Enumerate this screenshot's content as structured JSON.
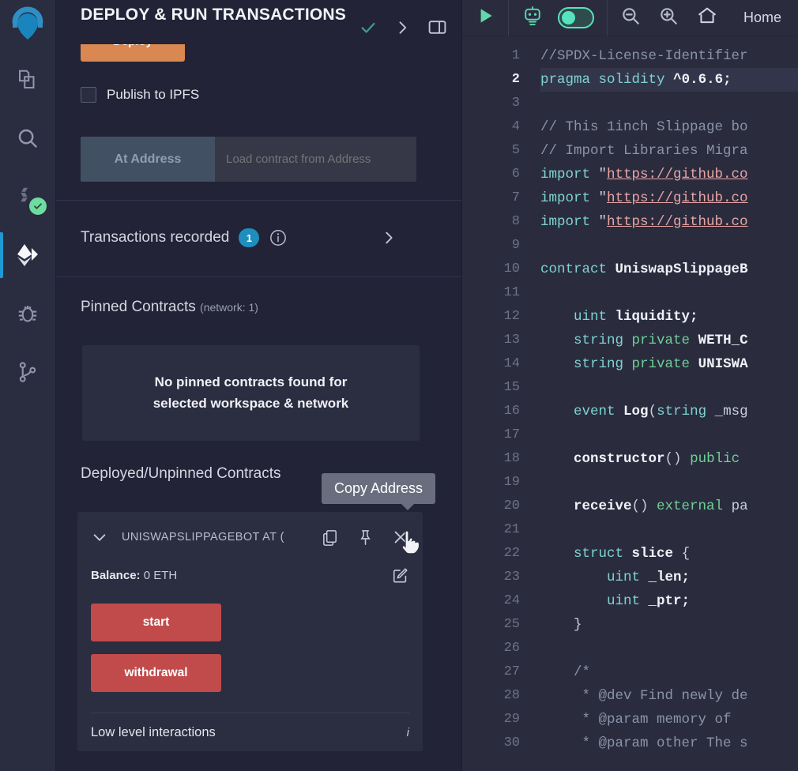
{
  "iconbar": {
    "logo_name": "remix-logo",
    "items": [
      {
        "name": "file-explorer-icon",
        "label": "File explorer",
        "active": false,
        "badge": false
      },
      {
        "name": "search-icon",
        "label": "Search in files",
        "active": false,
        "badge": false
      },
      {
        "name": "solidity-compiler-icon",
        "label": "Solidity compiler",
        "active": false,
        "badge": true
      },
      {
        "name": "deploy-run-icon",
        "label": "Deploy & run transactions",
        "active": true,
        "badge": false
      },
      {
        "name": "debugger-bug-icon",
        "label": "Debugger",
        "active": false,
        "badge": false
      },
      {
        "name": "git-branch-icon",
        "label": "Git",
        "active": false,
        "badge": false
      }
    ]
  },
  "panel": {
    "title": "Deploy & run transactions",
    "header_icons": [
      {
        "name": "check-icon",
        "label": "Checked"
      },
      {
        "name": "chevron-right-icon",
        "label": "Expand"
      },
      {
        "name": "panel-layout-icon",
        "label": "Toggle panel"
      }
    ],
    "deploy_button": "Deploy",
    "ipfs_checkbox_label": "Publish to IPFS",
    "at_address_button": "At Address",
    "at_address_placeholder": "Load contract from Address",
    "at_address_value": "",
    "transactions": {
      "label": "Transactions recorded",
      "count": "1",
      "info_icon": "info-icon",
      "caret_icon": "chevron-right-icon"
    },
    "pinned": {
      "title": "Pinned Contracts",
      "network": "(network: 1)",
      "empty_line1": "No pinned contracts found for",
      "empty_line2": "selected workspace & network"
    },
    "deployed_title": "Deployed/Unpinned Contracts",
    "tooltip": "Copy Address",
    "contract": {
      "name": "UNISWAPSLIPPAGEBOT AT (",
      "balance_label": "Balance:",
      "balance_value": "0 ETH",
      "actions": [
        {
          "name": "copy-address-icon",
          "label": "Copy Address"
        },
        {
          "name": "pin-icon",
          "label": "Pin contract"
        },
        {
          "name": "close-icon",
          "label": "Remove contract"
        }
      ],
      "edit_icon": "edit-balance-icon",
      "functions": [
        {
          "label": "start"
        },
        {
          "label": "withdrawal"
        }
      ],
      "low_level_label": "Low level interactions",
      "low_level_info": "i"
    }
  },
  "editor": {
    "toolbar": [
      {
        "name": "run-play-icon",
        "label": "Run"
      },
      {
        "name": "robot-ai-icon",
        "label": "AI assistant"
      },
      {
        "name": "ai-toggle-switch",
        "label": "AI toggle",
        "state": "on"
      },
      {
        "name": "zoom-out-icon",
        "label": "Zoom out"
      },
      {
        "name": "zoom-in-icon",
        "label": "Zoom in"
      },
      {
        "name": "home-icon",
        "label": "Home"
      }
    ],
    "home_label": "Home",
    "active_line": 2,
    "scroll_down_icon": "double-chevron-down-icon",
    "lines": [
      {
        "n": 1,
        "tokens": [
          {
            "t": "//SPDX-License-Identifier",
            "c": "cmt"
          }
        ]
      },
      {
        "n": 2,
        "tokens": [
          {
            "t": "pragma",
            "c": "kw"
          },
          {
            "t": " ",
            "c": "plain"
          },
          {
            "t": "solidity",
            "c": "kw"
          },
          {
            "t": " ",
            "c": "plain"
          },
          {
            "t": "^0.6.6;",
            "c": "num"
          }
        ]
      },
      {
        "n": 3,
        "tokens": []
      },
      {
        "n": 4,
        "tokens": [
          {
            "t": "// This 1inch Slippage bo",
            "c": "cmt"
          }
        ]
      },
      {
        "n": 5,
        "tokens": [
          {
            "t": "// Import Libraries Migra",
            "c": "cmt"
          }
        ]
      },
      {
        "n": 6,
        "tokens": [
          {
            "t": "import",
            "c": "kw"
          },
          {
            "t": " \"",
            "c": "plain"
          },
          {
            "t": "https://github.co",
            "c": "str"
          }
        ]
      },
      {
        "n": 7,
        "tokens": [
          {
            "t": "import",
            "c": "kw"
          },
          {
            "t": " \"",
            "c": "plain"
          },
          {
            "t": "https://github.co",
            "c": "str"
          }
        ]
      },
      {
        "n": 8,
        "tokens": [
          {
            "t": "import",
            "c": "kw"
          },
          {
            "t": " \"",
            "c": "plain"
          },
          {
            "t": "https://github.co",
            "c": "str"
          }
        ]
      },
      {
        "n": 9,
        "tokens": []
      },
      {
        "n": 10,
        "tokens": [
          {
            "t": "contract",
            "c": "kw"
          },
          {
            "t": " ",
            "c": "plain"
          },
          {
            "t": "UniswapSlippageB",
            "c": "typ"
          }
        ]
      },
      {
        "n": 11,
        "tokens": []
      },
      {
        "n": 12,
        "tokens": [
          {
            "t": "    ",
            "c": "plain"
          },
          {
            "t": "uint",
            "c": "kw"
          },
          {
            "t": " ",
            "c": "plain"
          },
          {
            "t": "liquidity;",
            "c": "typ"
          }
        ]
      },
      {
        "n": 13,
        "tokens": [
          {
            "t": "    ",
            "c": "plain"
          },
          {
            "t": "string",
            "c": "kw"
          },
          {
            "t": " ",
            "c": "plain"
          },
          {
            "t": "private",
            "c": "kw2"
          },
          {
            "t": " ",
            "c": "plain"
          },
          {
            "t": "WETH_C",
            "c": "typ"
          }
        ]
      },
      {
        "n": 14,
        "tokens": [
          {
            "t": "    ",
            "c": "plain"
          },
          {
            "t": "string",
            "c": "kw"
          },
          {
            "t": " ",
            "c": "plain"
          },
          {
            "t": "private",
            "c": "kw2"
          },
          {
            "t": " ",
            "c": "plain"
          },
          {
            "t": "UNISWA",
            "c": "typ"
          }
        ]
      },
      {
        "n": 15,
        "tokens": []
      },
      {
        "n": 16,
        "tokens": [
          {
            "t": "    ",
            "c": "plain"
          },
          {
            "t": "event",
            "c": "kw"
          },
          {
            "t": " ",
            "c": "plain"
          },
          {
            "t": "Log",
            "c": "fn"
          },
          {
            "t": "(",
            "c": "plain"
          },
          {
            "t": "string",
            "c": "kw"
          },
          {
            "t": " _msg",
            "c": "plain"
          }
        ]
      },
      {
        "n": 17,
        "tokens": []
      },
      {
        "n": 18,
        "tokens": [
          {
            "t": "    ",
            "c": "plain"
          },
          {
            "t": "constructor",
            "c": "fn"
          },
          {
            "t": "() ",
            "c": "plain"
          },
          {
            "t": "public",
            "c": "kw2"
          }
        ]
      },
      {
        "n": 19,
        "tokens": []
      },
      {
        "n": 20,
        "tokens": [
          {
            "t": "    ",
            "c": "plain"
          },
          {
            "t": "receive",
            "c": "fn"
          },
          {
            "t": "() ",
            "c": "plain"
          },
          {
            "t": "external",
            "c": "kw2"
          },
          {
            "t": " pa",
            "c": "plain"
          }
        ]
      },
      {
        "n": 21,
        "tokens": []
      },
      {
        "n": 22,
        "tokens": [
          {
            "t": "    ",
            "c": "plain"
          },
          {
            "t": "struct",
            "c": "kw"
          },
          {
            "t": " ",
            "c": "plain"
          },
          {
            "t": "slice",
            "c": "typ"
          },
          {
            "t": " {",
            "c": "plain"
          }
        ]
      },
      {
        "n": 23,
        "tokens": [
          {
            "t": "        ",
            "c": "plain"
          },
          {
            "t": "uint",
            "c": "kw"
          },
          {
            "t": " ",
            "c": "plain"
          },
          {
            "t": "_len;",
            "c": "typ"
          }
        ]
      },
      {
        "n": 24,
        "tokens": [
          {
            "t": "        ",
            "c": "plain"
          },
          {
            "t": "uint",
            "c": "kw"
          },
          {
            "t": " ",
            "c": "plain"
          },
          {
            "t": "_ptr;",
            "c": "typ"
          }
        ]
      },
      {
        "n": 25,
        "tokens": [
          {
            "t": "    }",
            "c": "plain"
          }
        ]
      },
      {
        "n": 26,
        "tokens": []
      },
      {
        "n": 27,
        "tokens": [
          {
            "t": "    /*",
            "c": "cmt"
          }
        ]
      },
      {
        "n": 28,
        "tokens": [
          {
            "t": "     * @dev Find newly de",
            "c": "cmt"
          }
        ]
      },
      {
        "n": 29,
        "tokens": [
          {
            "t": "     * @param memory of ",
            "c": "cmt"
          }
        ]
      },
      {
        "n": 30,
        "tokens": [
          {
            "t": "     * @param other The s",
            "c": "cmt"
          }
        ]
      }
    ]
  }
}
